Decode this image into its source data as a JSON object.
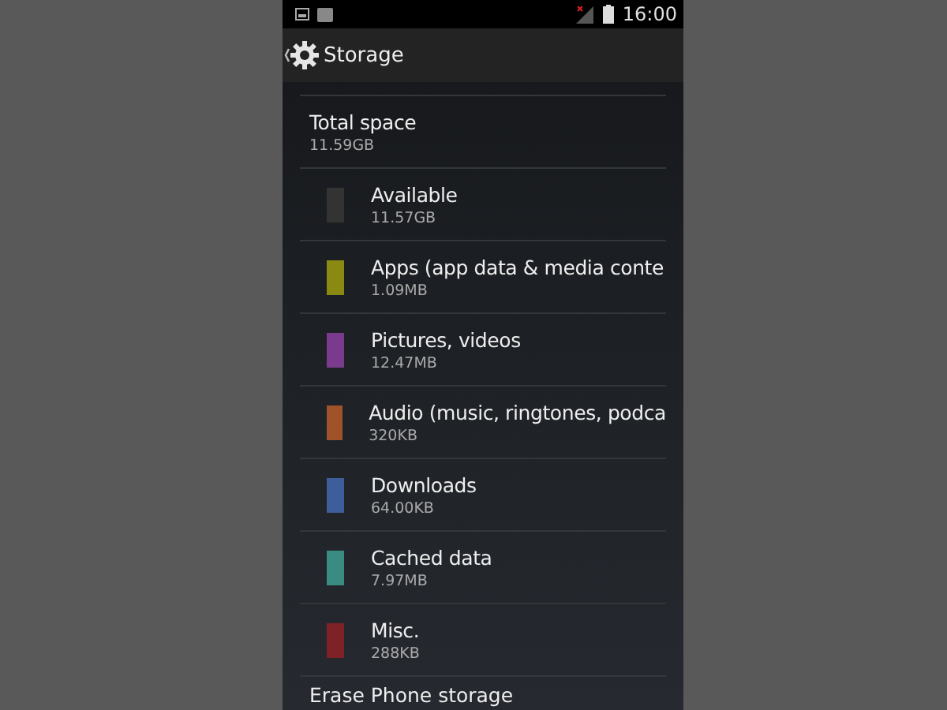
{
  "status_bar": {
    "time": "16:00"
  },
  "action_bar": {
    "title": "Storage"
  },
  "total": {
    "title": "Total space",
    "value": "11.59GB"
  },
  "items": [
    {
      "name": "Available",
      "value": "11.57GB",
      "color": "#333333"
    },
    {
      "name": "Apps (app data & media conte",
      "value": "1.09MB",
      "color": "#8a8a12"
    },
    {
      "name": "Pictures, videos",
      "value": "12.47MB",
      "color": "#7a3a8e"
    },
    {
      "name": "Audio (music, ringtones, podca",
      "value": "320KB",
      "color": "#a0522a"
    },
    {
      "name": "Downloads",
      "value": "64.00KB",
      "color": "#3d5e9a"
    },
    {
      "name": "Cached data",
      "value": "7.97MB",
      "color": "#3a8c82"
    },
    {
      "name": "Misc.",
      "value": "288KB",
      "color": "#7e2228"
    }
  ],
  "erase": {
    "label": "Erase Phone storage"
  }
}
